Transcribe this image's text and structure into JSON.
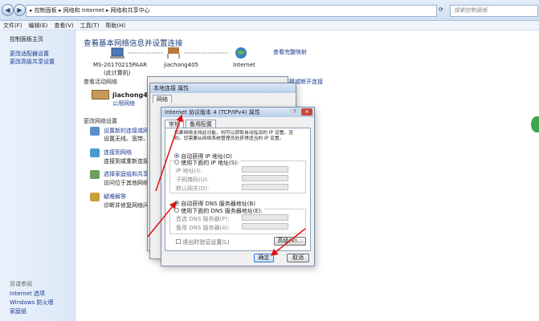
{
  "addressbar": {
    "breadcrumb": "▸ 控制面板 ▸ 网络和 Internet ▸ 网络和共享中心",
    "search_placeholder": "搜索控制面板"
  },
  "menu": [
    "文件(F)",
    "编辑(E)",
    "查看(V)",
    "工具(T)",
    "帮助(H)"
  ],
  "sidebar": {
    "items": [
      "控制面板主页",
      "更改适配器设置",
      "更改高级共享设置"
    ],
    "see_also_label": "另请参阅",
    "see_also": [
      "Internet 选项",
      "Windows 防火墙",
      "家庭组"
    ]
  },
  "main": {
    "title": "查看基本网络信息并设置连接",
    "view_full_map": "查看完整映射",
    "map": {
      "computer": "MS-20170215PAAR",
      "computer_sub": "(此计算机)",
      "network": "jiachong405",
      "internet": "Internet"
    },
    "active_label": "查看活动网络",
    "network_name": "jiachong405",
    "network_type": "公用网络",
    "connect_link": "接或断开连接",
    "change_label": "更改网络设置",
    "tasks": [
      {
        "title": "设置新的连接或网络",
        "desc": "设置无线、宽带、拨号、"
      },
      {
        "title": "连接到网络",
        "desc": "连接到或重新连接到无线"
      },
      {
        "title": "选择家庭组和共享选项",
        "desc": "访问位于其他网络计算机"
      },
      {
        "title": "疑难解答",
        "desc": "诊断并修复网络问题，或"
      }
    ]
  },
  "props_window": {
    "title": "本地连接 属性",
    "tab": "网络"
  },
  "ipv4": {
    "title": "Internet 协议版本 4 (TCP/IPv4) 属性",
    "tabs": [
      "常规",
      "备用配置"
    ],
    "desc": "如果网络支持此功能，则可以获取自动指派的 IP 设置。否则，您需要从网络系统管理员处获得适当的 IP 设置。",
    "auto_ip": "自动获得 IP 地址(O)",
    "manual_ip": "使用下面的 IP 地址(S):",
    "ip_fields": [
      "IP 地址(I):",
      "子网掩码(U):",
      "默认网关(D):"
    ],
    "auto_dns": "自动获得 DNS 服务器地址(B)",
    "manual_dns": "使用下面的 DNS 服务器地址(E):",
    "dns_fields": [
      "首选 DNS 服务器(P):",
      "备用 DNS 服务器(A):"
    ],
    "validate": "退出时验证设置(L)",
    "advanced": "高级(V)...",
    "ok": "确定",
    "cancel": "取消"
  }
}
